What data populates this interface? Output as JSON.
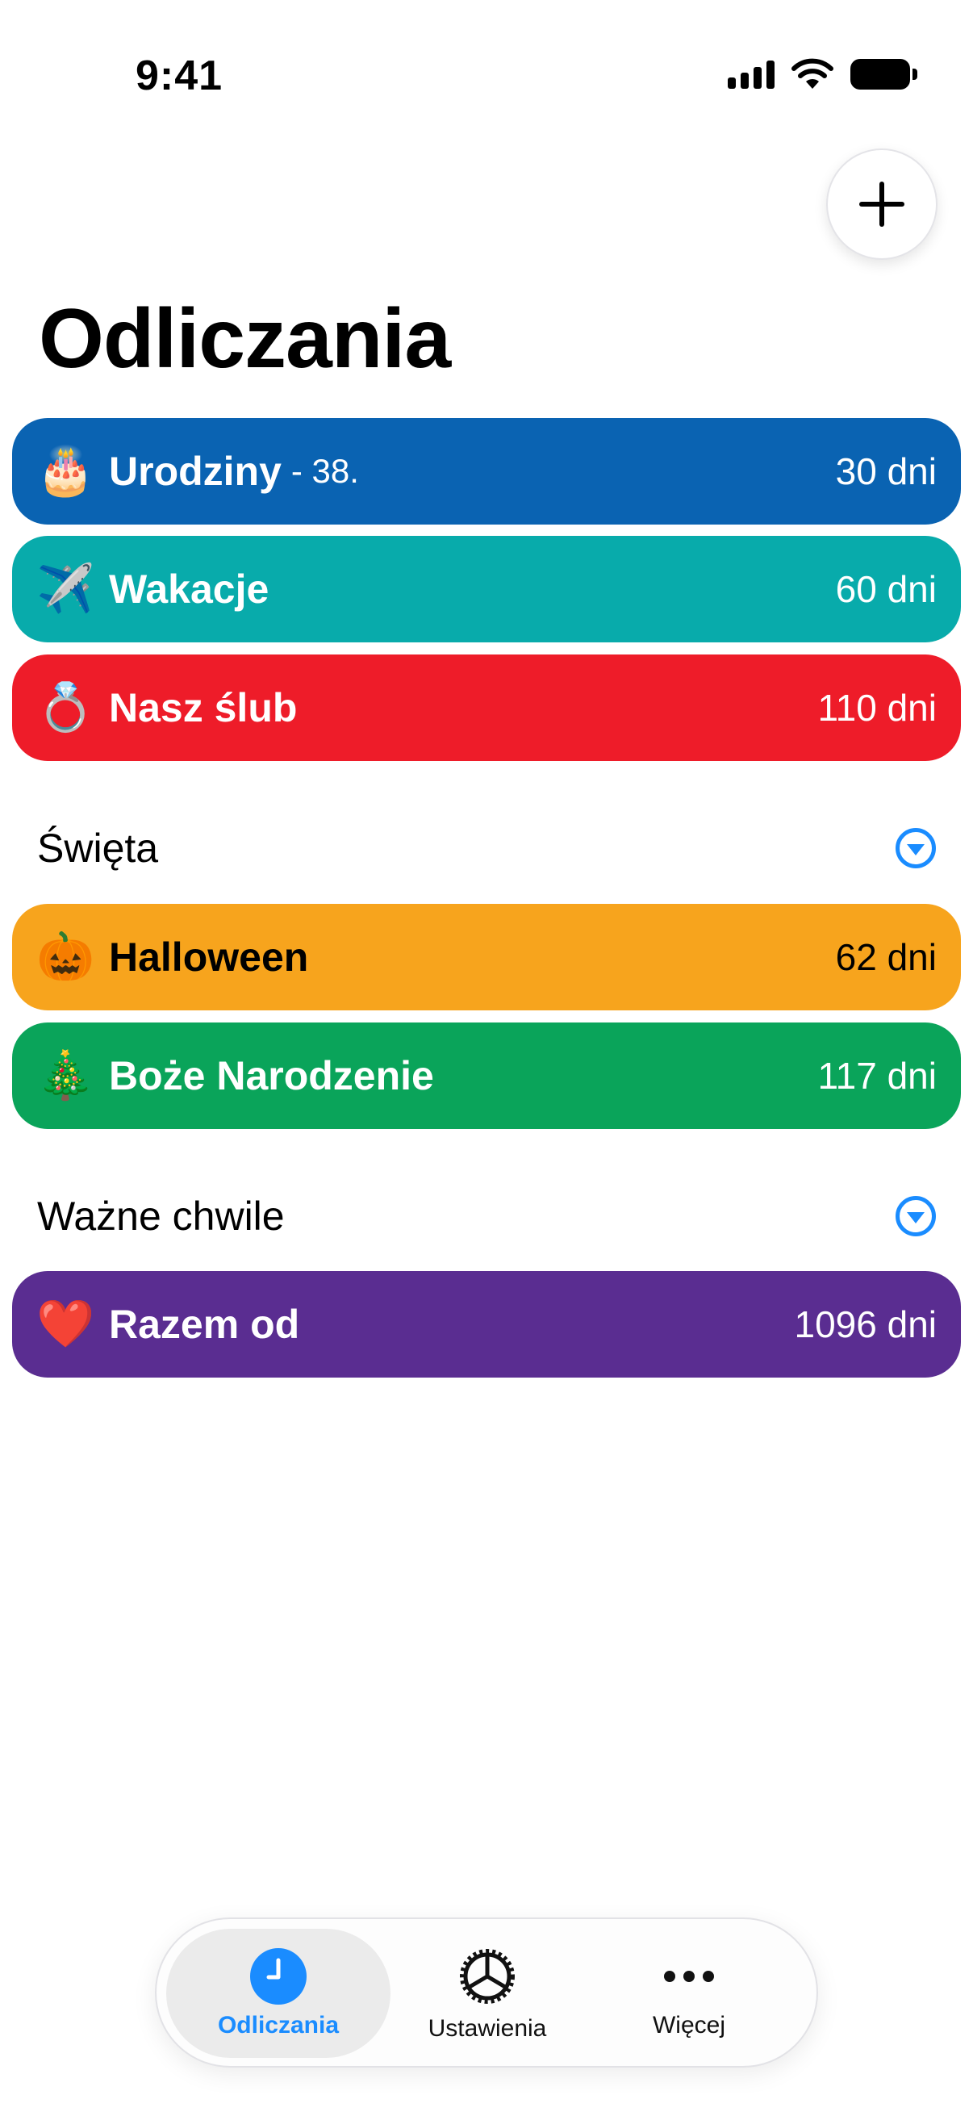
{
  "status_bar": {
    "time": "9:41"
  },
  "header": {
    "title": "Odliczania",
    "add_icon": "plus-icon"
  },
  "countdowns": [
    {
      "emoji": "🎂",
      "name": "Urodziny",
      "sub": "- 38.",
      "days": "30 dni",
      "color": "#0A63B2"
    },
    {
      "emoji": "✈️",
      "name": "Wakacje",
      "sub": "",
      "days": "60 dni",
      "color": "#08ABAB"
    },
    {
      "emoji": "💍",
      "name": "Nasz ślub",
      "sub": "",
      "days": "110 dni",
      "color": "#EE1C29"
    }
  ],
  "sections": [
    {
      "title": "Święta",
      "icon": "chevron-down-circle-icon",
      "items": [
        {
          "emoji": "🎃",
          "name": "Halloween",
          "days": "62 dni",
          "color": "#F7A41D"
        },
        {
          "emoji": "🎄",
          "name": "Boże Narodzenie",
          "days": "117 dni",
          "color": "#0AA45A"
        }
      ]
    },
    {
      "title": "Ważne chwile",
      "icon": "chevron-down-circle-icon",
      "items": [
        {
          "emoji": "❤️",
          "name": "Razem od",
          "days": "1096 dni",
          "color": "#5A2D91"
        }
      ]
    }
  ],
  "tab_bar": {
    "tabs": [
      {
        "label": "Odliczania",
        "icon": "clock-icon",
        "active": true
      },
      {
        "label": "Ustawienia",
        "icon": "gear-icon",
        "active": false
      },
      {
        "label": "Więcej",
        "icon": "ellipsis-icon",
        "active": false
      }
    ],
    "accent": "#1A8CFF"
  }
}
